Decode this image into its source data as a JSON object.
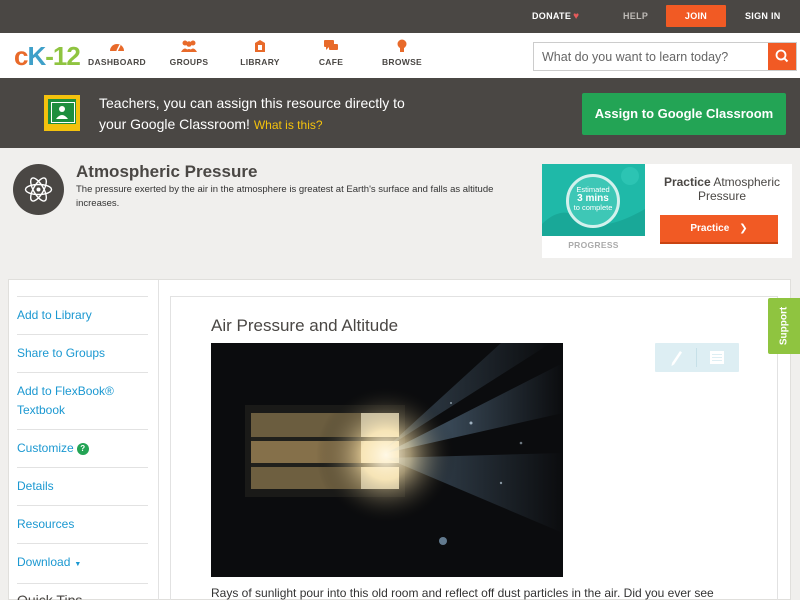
{
  "topbar": {
    "donate": "DONATE",
    "help": "HELP",
    "join": "JOIN",
    "signin": "SIGN IN"
  },
  "logo": {
    "c": "c",
    "k": "K",
    "dash": "-",
    "n": "12"
  },
  "nav": {
    "dashboard": "DASHBOARD",
    "groups": "GROUPS",
    "library": "LIBRARY",
    "cafe": "CAFE",
    "browse": "BROWSE"
  },
  "search": {
    "placeholder": "What do you want to learn today?"
  },
  "banner": {
    "line1": "Teachers, you can assign this resource directly to",
    "line2": "your Google Classroom!",
    "what": "What is this?",
    "assign": "Assign to Google Classroom"
  },
  "concept": {
    "title": "Atmospheric Pressure",
    "description": "The pressure exerted by the air in the atmosphere is greatest at Earth's surface and falls as altitude increases."
  },
  "practice": {
    "estimated": "Estimated",
    "mins": "3 mins",
    "to_complete": "to complete",
    "progress": "PROGRESS",
    "title_bold": "Practice",
    "title_rest": "Atmospheric Pressure",
    "button": "Practice"
  },
  "sidebar": {
    "add_library": "Add to Library",
    "share_groups": "Share to Groups",
    "add_flexbook": "Add to FlexBook®",
    "textbook": "Textbook",
    "customize": "Customize",
    "details": "Details",
    "resources": "Resources",
    "download": "Download",
    "quick_tips": "Quick Tips"
  },
  "content": {
    "title": "Air Pressure and Altitude",
    "caption": "Rays of sunlight pour into this old room and reflect off dust particles in the air. Did you ever see"
  },
  "support": "Support",
  "colors": {
    "brand_orange": "#f15a24",
    "dark_gray": "#4a4744",
    "google_green": "#23a455",
    "link_blue": "#1b98d1",
    "practice_teal": "#1fb9a8",
    "support_green": "#8fc440"
  }
}
